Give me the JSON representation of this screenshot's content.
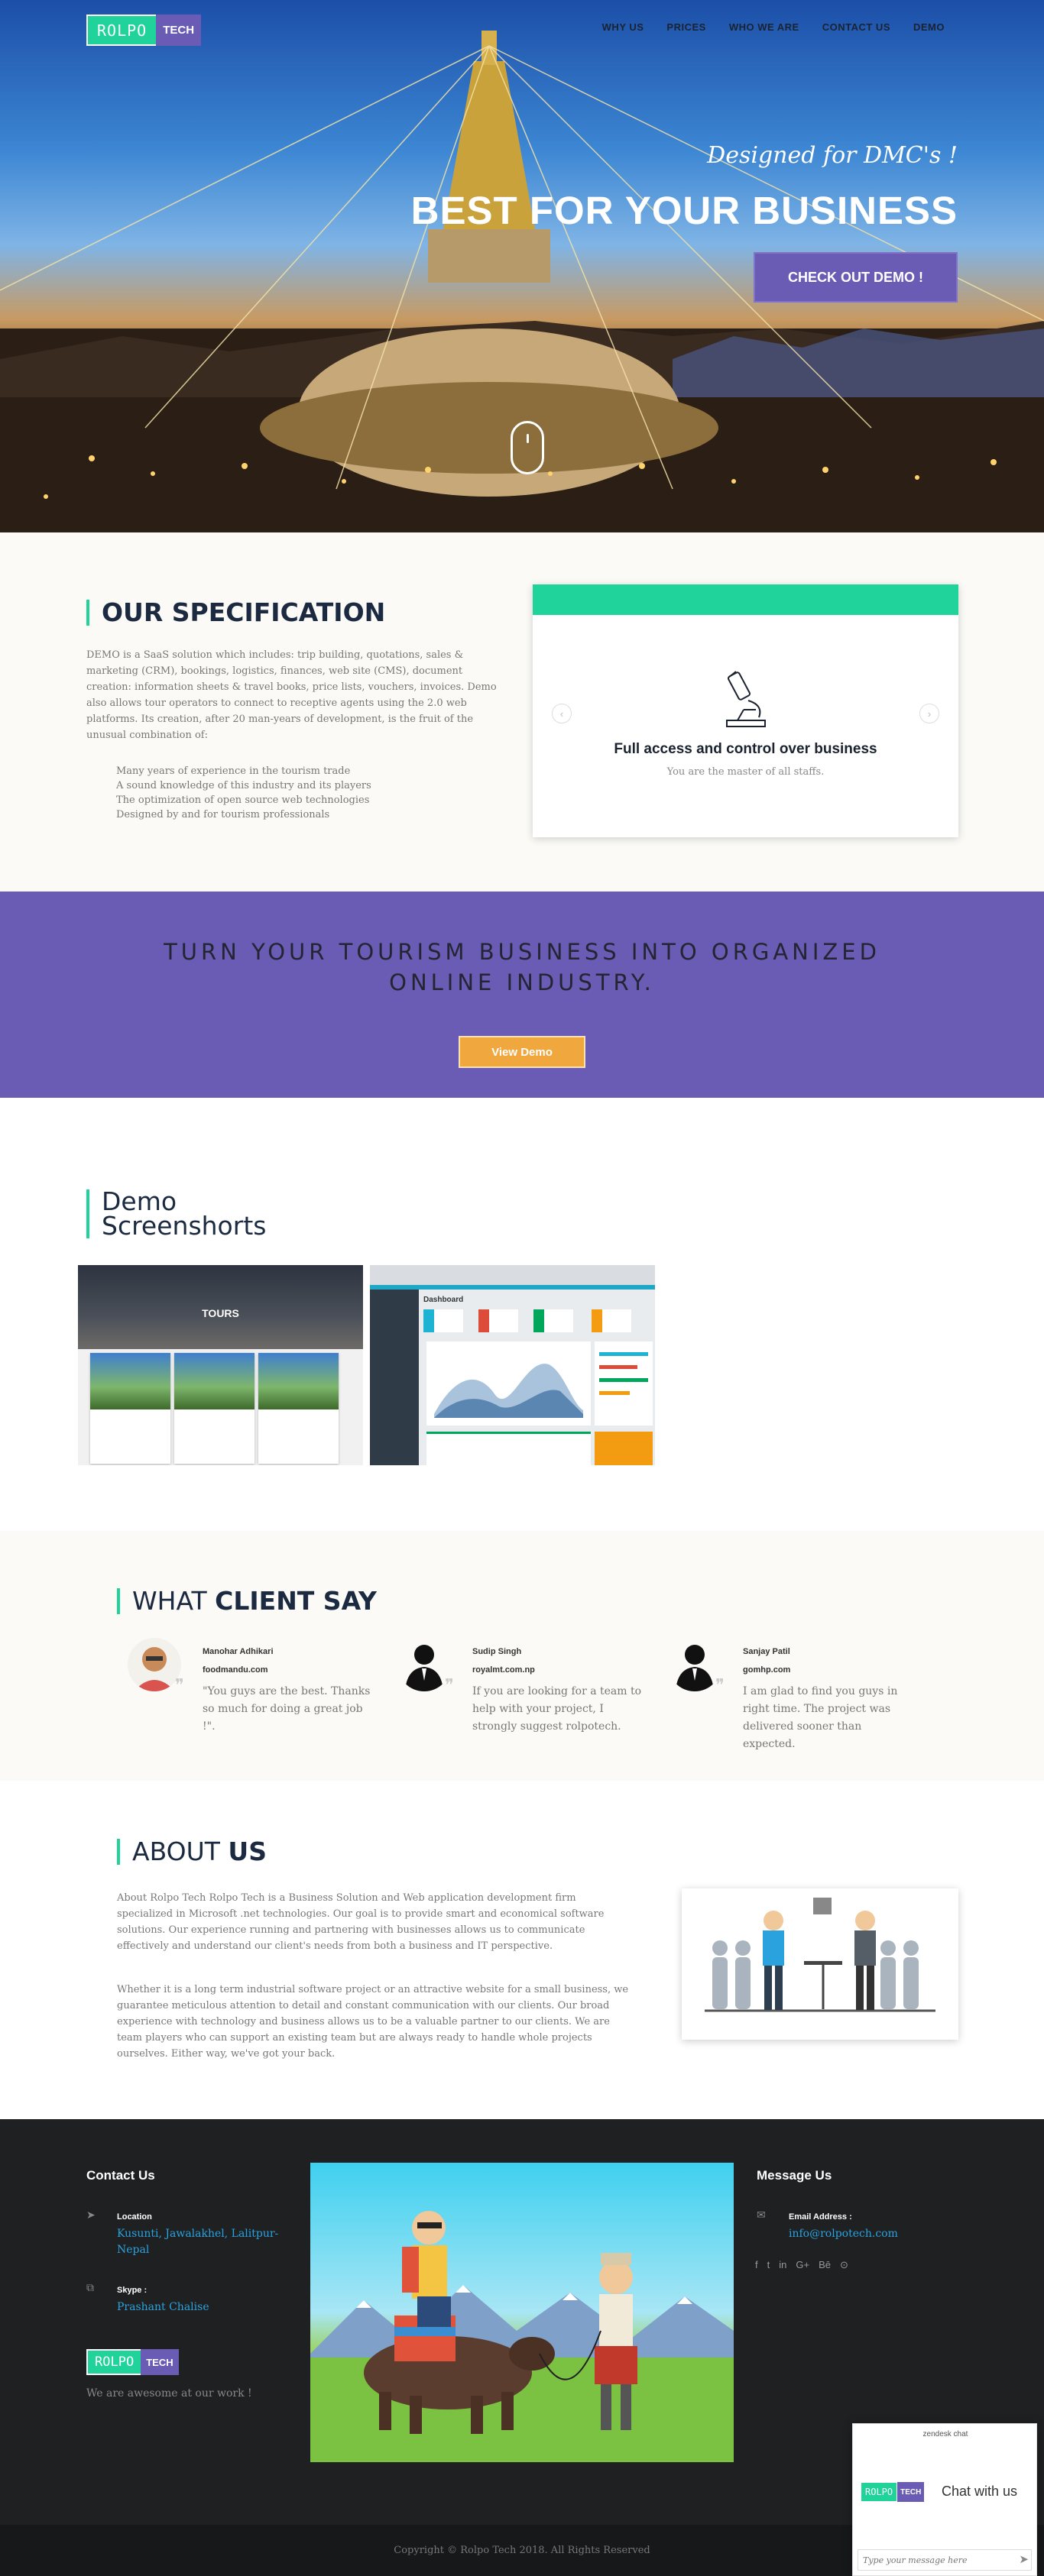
{
  "header": {
    "logo_part1": "ROLPO",
    "logo_part2": "TECH",
    "nav": [
      "WHY US",
      "PRICES",
      "WHO WE ARE",
      "CONTACT US",
      "DEMO"
    ]
  },
  "hero": {
    "tagline": "Designed for DMC's !",
    "headline": "BEST FOR YOUR BUSINESS",
    "cta": "CHECK OUT DEMO !"
  },
  "spec": {
    "title_light": "OUR",
    "title_bold": "SPECIFICATION",
    "paragraph": "DEMO is a SaaS solution which includes: trip building, quotations, sales & marketing (CRM), bookings, logistics, finances, web site (CMS), document creation: information sheets & travel books, price lists, vouchers, invoices. Demo also allows tour operators to connect to receptive agents using the 2.0 web platforms. Its creation, after 20 man-years of development, is the fruit of the unusual combination of:",
    "list": [
      "Many years of experience in the tourism trade",
      "A sound knowledge of this industry and its players",
      "The optimization of open source web technologies",
      "Designed by and for tourism professionals"
    ],
    "card_title": "Full access and control over business",
    "card_text": "You are the master of all staffs.",
    "prev_arrow": "‹",
    "next_arrow": "›",
    "card_icon": "microscope-icon"
  },
  "banner": {
    "line1": "TURN YOUR TOURISM BUSINESS INTO ORGANIZED",
    "line2": "ONLINE INDUSTRY.",
    "button": "View Demo"
  },
  "demo": {
    "title1": "Demo",
    "title2": "Screenshorts",
    "shot1_label": "TOURS",
    "shot2_label": "Dashboard"
  },
  "clients": {
    "title_light": "WHAT",
    "title_bold": "CLIENT SAY",
    "items": [
      {
        "name": "Manohar Adhikari",
        "org": "foodmandu.com",
        "text": "\"You guys are the best. Thanks so much for doing a great job !\"."
      },
      {
        "name": "Sudip Singh",
        "org": "royalmt.com.np",
        "text": "If you are looking for a team to help with your project, I strongly suggest rolpotech."
      },
      {
        "name": "Sanjay Patil",
        "org": "gomhp.com",
        "text": "I am glad to find you guys in right time. The project was delivered sooner than expected."
      }
    ]
  },
  "about": {
    "title_light": "ABOUT",
    "title_bold": "US",
    "p1": "About Rolpo Tech Rolpo Tech is a Business Solution and Web application development firm specialized in Microsoft .net technologies. Our goal is to provide smart and economical software solutions. Our experience running and partnering with businesses allows us to communicate effectively and understand our client's needs from both a business and IT perspective.",
    "p2": "Whether it is a long term industrial software project or an attractive website for a small business, we guarantee meticulous attention to detail and constant communication with our clients. Our broad experience with technology and business allows us to be a valuable partner to our clients. We are team players who can support an existing team but are always ready to handle whole projects ourselves. Either way, we've got your back."
  },
  "footer": {
    "contact_title": "Contact Us",
    "location_label": "Location",
    "location_value1": "Kusunti, Jawalakhel, Lalitpur-",
    "location_value2": "Nepal",
    "skype_label": "Skype :",
    "skype_value": "Prashant Chalise",
    "tagline": "We are awesome at our work !",
    "message_title": "Message Us",
    "email_label": "Email Address :",
    "email_value": "info@rolpotech.com",
    "social": [
      "f",
      "t",
      "in",
      "G+",
      "Bē",
      "⊙"
    ],
    "copyright": "Copyright © Rolpo Tech 2018. All Rights Reserved"
  },
  "chat": {
    "title": "zendesk chat",
    "greeting": "Chat with us",
    "placeholder": "Type your message here"
  },
  "colors": {
    "accent_green": "#20d39a",
    "accent_purple": "#6a5bb4",
    "accent_orange": "#f0a73d",
    "footer_bg": "#1f2022",
    "link_blue": "#2aa2de"
  }
}
